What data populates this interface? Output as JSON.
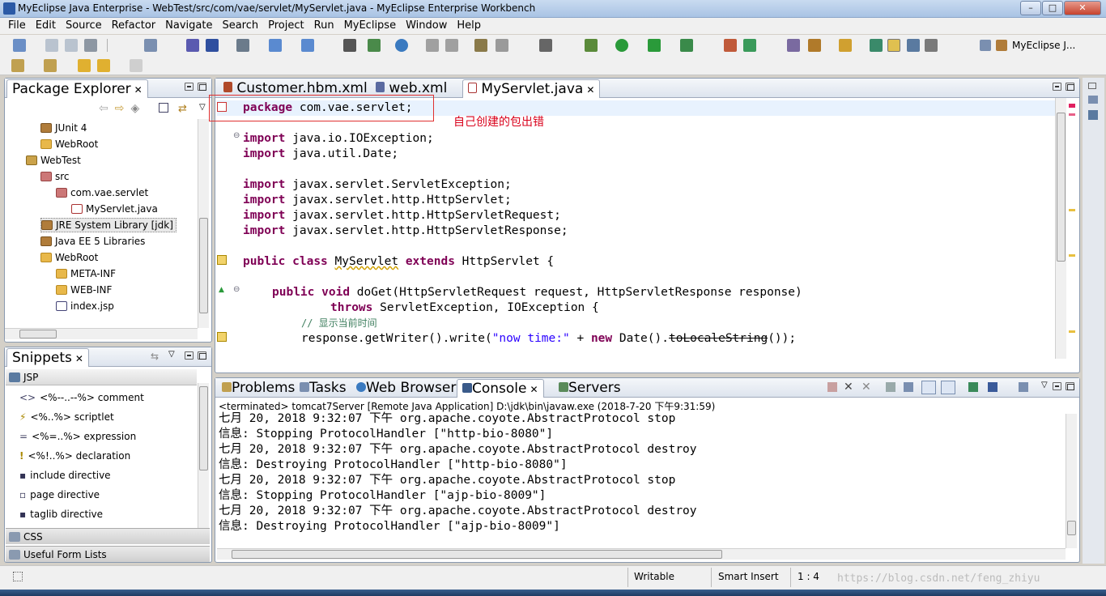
{
  "window": {
    "title": "MyEclipse Java Enterprise - WebTest/src/com/vae/servlet/MyServlet.java - MyEclipse Enterprise Workbench",
    "minimize": "–",
    "maximize": "□",
    "close": "✕"
  },
  "menu": [
    "File",
    "Edit",
    "Source",
    "Refactor",
    "Navigate",
    "Search",
    "Project",
    "Run",
    "MyEclipse",
    "Window",
    "Help"
  ],
  "perspective": {
    "label": "MyEclipse J..."
  },
  "package_explorer": {
    "title": "Package Explorer",
    "items": [
      {
        "label": "JUnit 4",
        "icon": "library-icon"
      },
      {
        "label": "WebRoot",
        "icon": "folder-icon"
      },
      {
        "label": "WebTest",
        "icon": "project-icon"
      },
      {
        "label": "src",
        "icon": "source-folder-icon"
      },
      {
        "label": "com.vae.servlet",
        "icon": "package-error-icon"
      },
      {
        "label": "MyServlet.java",
        "icon": "java-file-error-icon"
      },
      {
        "label": "JRE System Library [jdk]",
        "icon": "library-icon"
      },
      {
        "label": "Java EE 5 Libraries",
        "icon": "library-icon"
      },
      {
        "label": "WebRoot",
        "icon": "folder-icon"
      },
      {
        "label": "META-INF",
        "icon": "folder-icon"
      },
      {
        "label": "WEB-INF",
        "icon": "folder-icon"
      },
      {
        "label": "index.jsp",
        "icon": "jsp-file-icon"
      }
    ]
  },
  "snippets": {
    "title": "Snippets",
    "category": "JSP",
    "items": [
      {
        "glyph": "<>",
        "label": "<%--..--%> comment"
      },
      {
        "glyph": "⚡",
        "label": "<%..%> scriptlet"
      },
      {
        "glyph": "=",
        "label": "<%=..%> expression"
      },
      {
        "glyph": "!",
        "label": "<%!..%> declaration"
      },
      {
        "glyph": "▪",
        "label": "include directive"
      },
      {
        "glyph": "▫",
        "label": "page directive"
      },
      {
        "glyph": "▪",
        "label": "taglib directive"
      }
    ],
    "sections": [
      "CSS",
      "Useful Form Lists"
    ]
  },
  "editor": {
    "tabs": [
      {
        "label": "Customer.hbm.xml"
      },
      {
        "label": "web.xml"
      },
      {
        "label": "MyServlet.java",
        "close": "✕"
      }
    ],
    "lines": {
      "l1_kw": "package",
      "l1_rest": " com.vae.servlet;",
      "l3_kw": "import",
      "l3_rest": " java.io.IOException;",
      "l4_kw": "import",
      "l4_rest": " java.util.Date;",
      "l6_kw": "import",
      "l6_rest": " javax.servlet.ServletException;",
      "l7_kw": "import",
      "l7_rest": " javax.servlet.http.HttpServlet;",
      "l8_kw": "import",
      "l8_rest": " javax.servlet.http.HttpServletRequest;",
      "l9_kw": "import",
      "l9_rest": " javax.servlet.http.HttpServletResponse;",
      "l11_kw1": "public",
      "l11_kw2": "class",
      "l11_name": "MyServlet",
      "l11_kw3": "extends",
      "l11_rest": " HttpServlet {",
      "l13_kw1": "public",
      "l13_kw2": "void",
      "l13_rest": " doGet(HttpServletRequest request, HttpServletResponse response)",
      "l14_kw": "throws",
      "l14_rest": " ServletException, IOException {",
      "l15_comment": "// 显示当前时间",
      "l16_a": "response.getWriter().write(",
      "l16_str": "\"now time:\"",
      "l16_b": " + ",
      "l16_kw": "new",
      "l16_c": " Date().",
      "l16_dep": "toLocaleString",
      "l16_d": "());"
    },
    "annotation": "自己创建的包出错"
  },
  "bottom": {
    "tabs": [
      {
        "label": "Problems"
      },
      {
        "label": "Tasks"
      },
      {
        "label": "Web Browser"
      },
      {
        "label": "Console",
        "close": "✕"
      },
      {
        "label": "Servers"
      }
    ],
    "console_header": "<terminated> tomcat7Server [Remote Java Application] D:\\jdk\\bin\\javaw.exe (2018-7-20 下午9:31:59)",
    "console_lines": [
      "七月 20, 2018 9:32:07 下午 org.apache.coyote.AbstractProtocol stop",
      "信息: Stopping ProtocolHandler [\"http-bio-8080\"]",
      "七月 20, 2018 9:32:07 下午 org.apache.coyote.AbstractProtocol destroy",
      "信息: Destroying ProtocolHandler [\"http-bio-8080\"]",
      "七月 20, 2018 9:32:07 下午 org.apache.coyote.AbstractProtocol stop",
      "信息: Stopping ProtocolHandler [\"ajp-bio-8009\"]",
      "七月 20, 2018 9:32:07 下午 org.apache.coyote.AbstractProtocol destroy",
      "信息: Destroying ProtocolHandler [\"ajp-bio-8009\"]"
    ]
  },
  "status": {
    "writable": "Writable",
    "insert_mode": "Smart Insert",
    "position": "1 : 4",
    "watermark": "https://blog.csdn.net/feng_zhiyu"
  },
  "colors": {
    "keyword": "#7f0055",
    "string": "#2a00ff",
    "comment": "#3f7f5f",
    "annotation": "#d9001b"
  }
}
